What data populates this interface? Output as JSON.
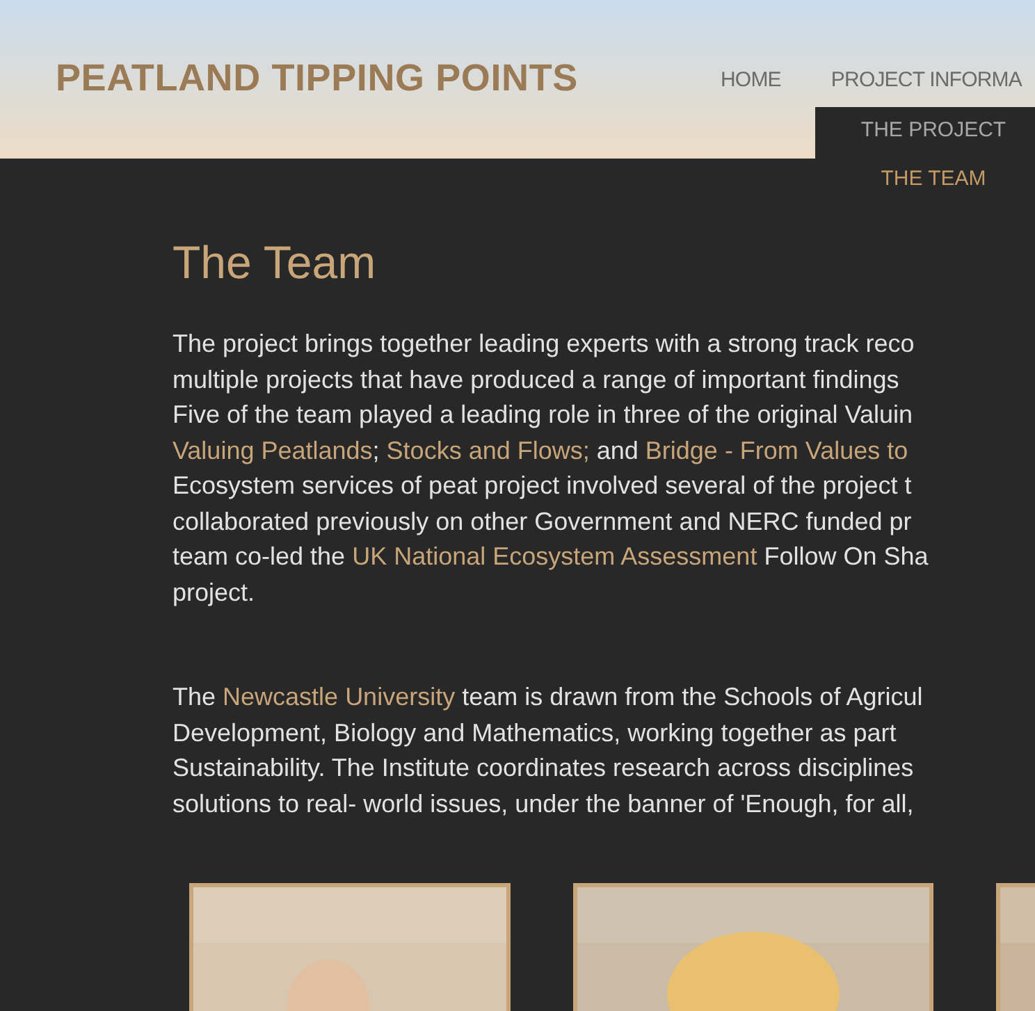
{
  "site_title": "PEATLAND TIPPING POINTS",
  "nav": [
    {
      "label": "HOME"
    },
    {
      "label": "PROJECT INFORMA"
    }
  ],
  "dropdown": [
    {
      "label": "THE PROJECT",
      "selected": false
    },
    {
      "label": "THE TEAM",
      "selected": true
    }
  ],
  "heading": "The Team",
  "paragraphs": [
    [
      [
        {
          "text": "The project brings together leading experts with a strong track reco"
        }
      ],
      [
        {
          "text": "multiple projects that have produced a range of important findings"
        }
      ],
      [
        {
          "text": "Five of the team played a leading role in three of the original Valuin"
        }
      ],
      [
        {
          "text": "Valuing Peatlands",
          "link": true
        },
        {
          "text": "; "
        },
        {
          "text": "Stocks and Flows;",
          "link": true
        },
        {
          "text": " and "
        },
        {
          "text": "Bridge - From Values to",
          "link": true
        }
      ],
      [
        {
          "text": "Ecosystem services of peat project involved several of the project t"
        }
      ],
      [
        {
          "text": "collaborated previously on other Government and NERC funded pr"
        }
      ],
      [
        {
          "text": "team co-led the "
        },
        {
          "text": "UK National Ecosystem Assessment",
          "link": true
        },
        {
          "text": " Follow On Sha"
        }
      ],
      [
        {
          "text": "project."
        }
      ]
    ],
    [
      [
        {
          "text": "The "
        },
        {
          "text": "Newcastle University",
          "link": true
        },
        {
          "text": " team is drawn from the Schools of Agricul"
        }
      ],
      [
        {
          "text": "Development, Biology and Mathematics, working together as part"
        }
      ],
      [
        {
          "text": "Sustainability. The Institute coordinates research across disciplines"
        }
      ],
      [
        {
          "text": "solutions to real- world issues, under the banner of 'Enough, for all,"
        }
      ]
    ]
  ],
  "team_photos": [
    {
      "kind": "picture"
    },
    {
      "kind": "picture"
    },
    {
      "kind": "picture"
    }
  ]
}
